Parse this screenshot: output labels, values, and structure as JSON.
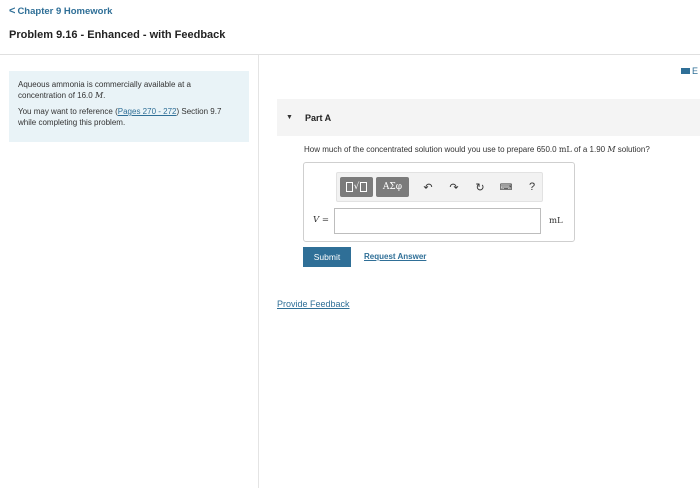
{
  "header": {
    "back_chevron": "<",
    "back_label": "Chapter 9 Homework",
    "problem_title": "Problem 9.16 - Enhanced - with Feedback"
  },
  "info": {
    "line1_a": "Aqueous ammonia is commercially available at a concentration of 16.0 ",
    "line1_unit": "M",
    "line1_b": ".",
    "line2_a": "You may want to reference (",
    "line2_link": "Pages 270 - 272",
    "line2_b": ") Section 9.7 while completing this problem."
  },
  "top_right": {
    "icon": "book-icon",
    "text": "E"
  },
  "part": {
    "toggle_icon": "▼",
    "label": "Part A"
  },
  "question": {
    "text_a": "How much of the concentrated solution would you use to prepare 650.0 ",
    "unit1": "mL",
    "text_b": " of a 1.90 ",
    "unit2": "M",
    "text_c": " solution?"
  },
  "toolbar": {
    "template_radical": "√",
    "greek": "ΑΣφ",
    "undo": "↶",
    "redo": "↷",
    "reset": "↻",
    "keyboard": "⌨",
    "help": "?"
  },
  "answer": {
    "var": "V",
    "eq": " =",
    "value": "",
    "unit": "mL"
  },
  "actions": {
    "submit": "Submit",
    "request": "Request Answer",
    "feedback": "Provide Feedback"
  },
  "colors": {
    "accent": "#2f6f97",
    "info_bg": "#e9f3f7",
    "part_bg": "#f4f4f4",
    "toolbar_btn": "#7b7b7b"
  }
}
